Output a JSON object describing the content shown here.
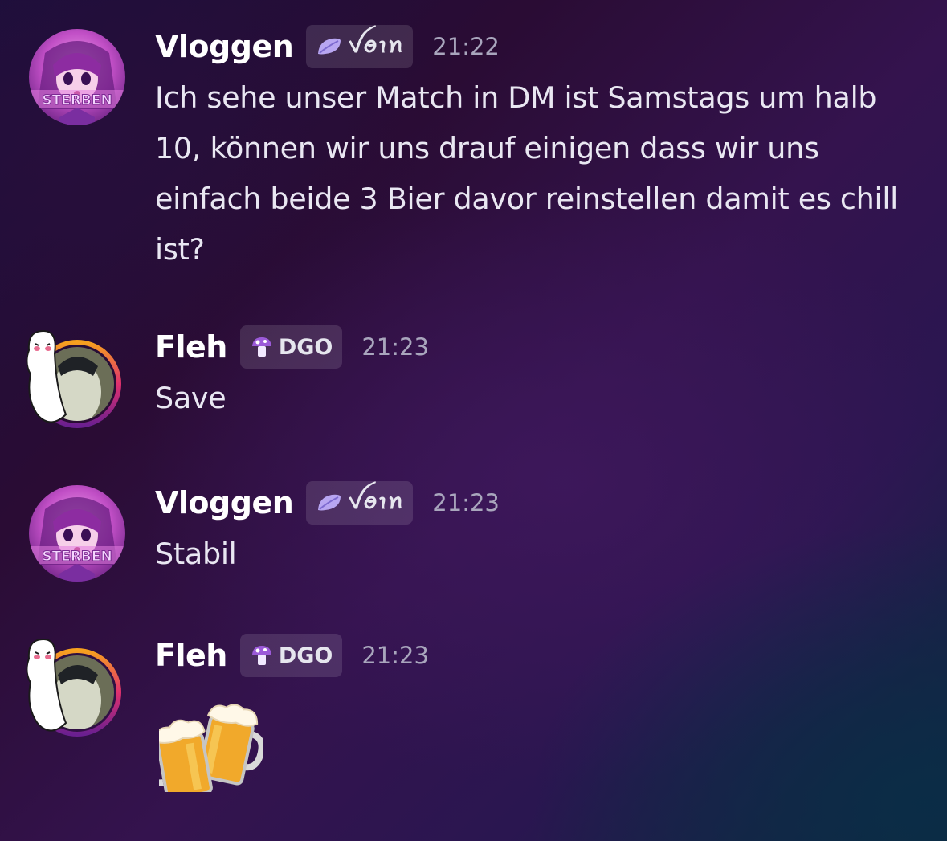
{
  "messages": [
    {
      "author": "Vloggen",
      "tag": "ꪜꪮꪱꪀ",
      "tag_icon": "lavender-leaf-icon",
      "avatar": "anime-girl-avatar",
      "avatar_text": "STERBEN",
      "time": "21:22",
      "text": "Ich sehe unser Match in DM ist Samstags um halb 10, können wir uns drauf einigen dass wir uns einfach beide 3 Bier davor reinstellen damit es chill ist?"
    },
    {
      "author": "Fleh",
      "tag": "DGO",
      "tag_icon": "purple-mushroom-icon",
      "avatar": "penguin-ghost-avatar",
      "time": "21:23",
      "text": "Save"
    },
    {
      "author": "Vloggen",
      "tag": "ꪜꪮꪱꪀ",
      "tag_icon": "lavender-leaf-icon",
      "avatar": "anime-girl-avatar",
      "avatar_text": "STERBEN",
      "time": "21:23",
      "text": "Stabil"
    },
    {
      "author": "Fleh",
      "tag": "DGO",
      "tag_icon": "purple-mushroom-icon",
      "avatar": "penguin-ghost-avatar",
      "time": "21:23",
      "emoji": "beer-mugs-icon"
    }
  ],
  "colors": {
    "tag_bg": "#3a2a4e",
    "timestamp": "#a9a6bd",
    "username": "#ffffff",
    "message_text": "#e9e7f2",
    "avatar_ring_orange": "#f7931e",
    "avatar_ring_pink": "#e0306f"
  }
}
